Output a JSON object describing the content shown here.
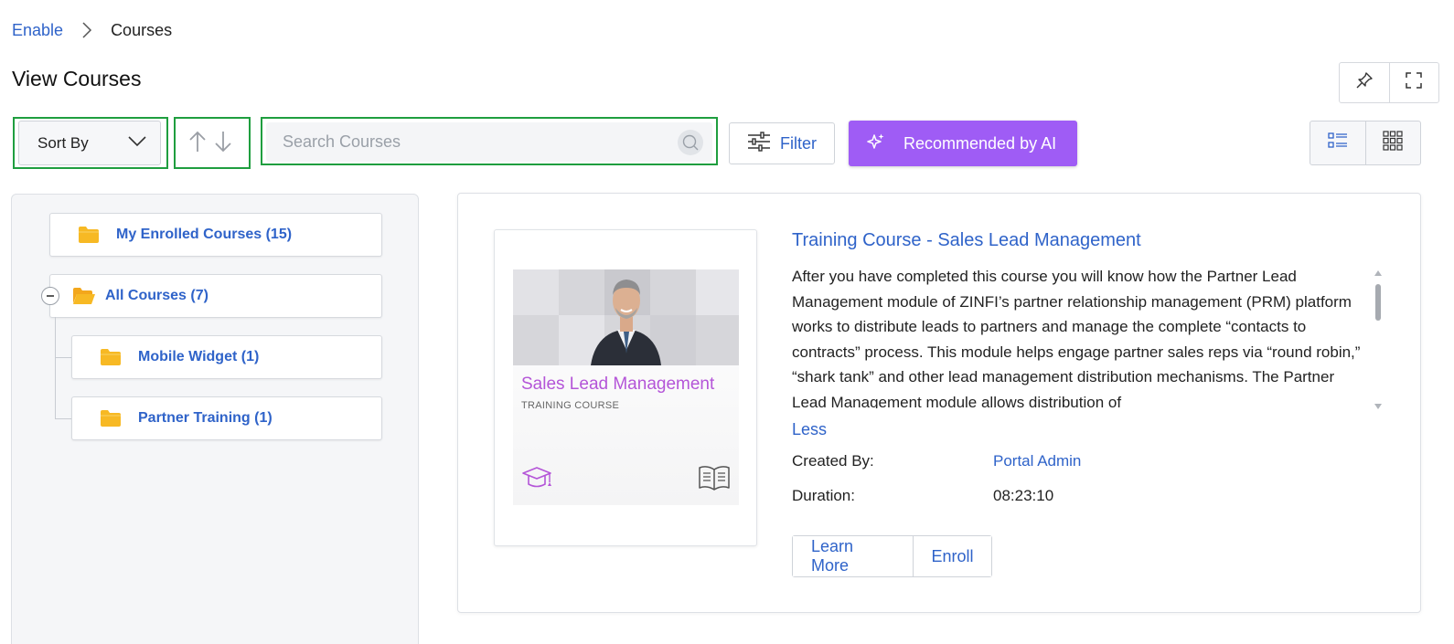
{
  "breadcrumb": {
    "root": "Enable",
    "current": "Courses"
  },
  "page": {
    "title": "View Courses"
  },
  "toolbar": {
    "sort_label": "Sort By",
    "search_placeholder": "Search Courses",
    "filter_label": "Filter",
    "ai_label": "Recommended by AI"
  },
  "tree": {
    "enrolled": "My Enrolled Courses (15)",
    "all": "All Courses (7)",
    "children": [
      "Mobile Widget (1)",
      "Partner Training (1)"
    ]
  },
  "course": {
    "title": "Training Course - Sales Lead Management",
    "description": "After you have completed this course you will know how the Partner Lead Management module of ZINFI’s partner relationship management (PRM) platform works to distribute leads to partners and manage the complete “contacts to contracts” process. This module helps engage partner sales reps via “round robin,” “shark tank” and other lead management distribution mechanisms. The Partner Lead Management module allows distribution of",
    "thumb_title": "Sales Lead Management",
    "thumb_subtitle": "TRAINING COURSE",
    "less_label": "Less",
    "created_by_label": "Created By:",
    "created_by_value": "Portal Admin",
    "duration_label": "Duration:",
    "duration_value": "08:23:10",
    "learn_more_label": "Learn More",
    "enroll_label": "Enroll"
  },
  "icons": {
    "breadcrumb_separator": "chevron-right-icon",
    "pin": "pin-icon",
    "fullscreen": "fullscreen-icon",
    "sort_dropdown": "chevron-down-icon",
    "sort_asc": "arrow-up-icon",
    "sort_desc": "arrow-down-icon",
    "search": "search-icon",
    "filter": "sliders-icon",
    "ai": "sparkle-icon",
    "list_view": "list-view-icon",
    "grid_view": "grid-view-icon",
    "folder": "folder-icon",
    "collapse": "minus-circle-icon",
    "graduation": "graduation-cap-icon",
    "book": "open-book-icon"
  },
  "colors": {
    "link": "#2f63c9",
    "ai_button": "#9f5cf5",
    "highlight": "#1f9e3f",
    "folder": "#f7b924",
    "thumb_accent": "#b455d8"
  }
}
